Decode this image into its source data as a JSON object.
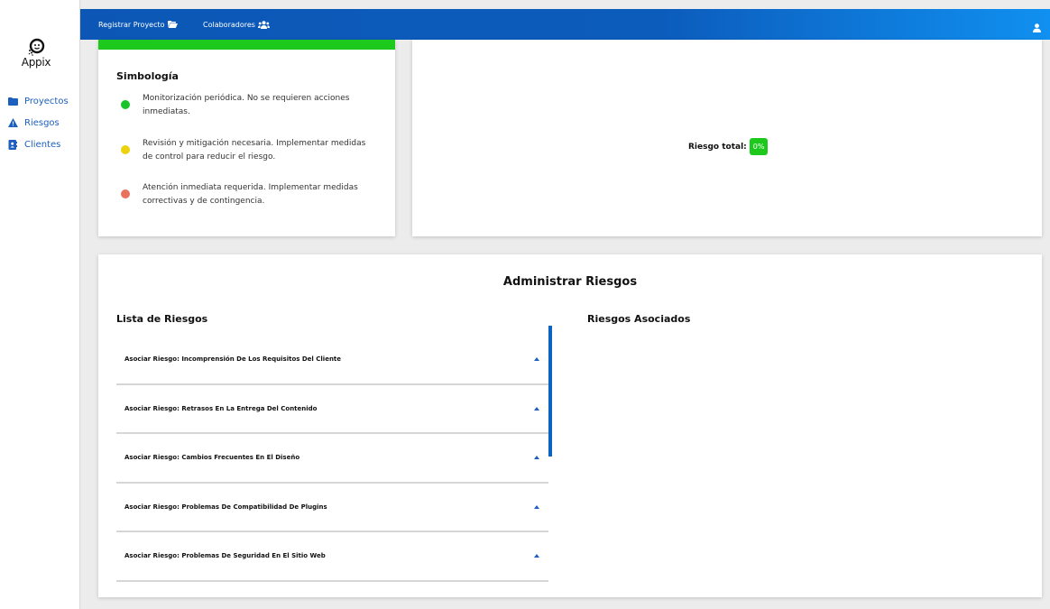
{
  "app": {
    "logo_text": "Appix"
  },
  "sidebar": {
    "items": [
      {
        "label": "Proyectos",
        "icon": "folder-icon"
      },
      {
        "label": "Riesgos",
        "icon": "warning-icon"
      },
      {
        "label": "Clientes",
        "icon": "contact-book-icon"
      }
    ]
  },
  "topbar": {
    "links": [
      {
        "label": "Registrar Proyecto",
        "icon": "folder-open-icon"
      },
      {
        "label": "Colaboradores",
        "icon": "users-icon"
      }
    ],
    "user_icon": "user-icon"
  },
  "simbologia": {
    "title": "Simbología",
    "items": [
      {
        "color": "#19c42a",
        "text": "Monitorización periódica. No se requieren acciones inmediatas."
      },
      {
        "color": "#ecd20c",
        "text": "Revisión y mitigación necesaria. Implementar medidas de control para reducir el riesgo."
      },
      {
        "color": "#e8725d",
        "text": "Atención inmediata requerida. Implementar medidas correctivas y de contingencia."
      }
    ]
  },
  "riesgo_total": {
    "label": "Riesgo total:",
    "value": "0%"
  },
  "admin": {
    "title": "Administrar Riesgos",
    "list_title": "Lista de Riesgos",
    "assoc_title": "Riesgos Asociados",
    "risks": [
      "Asociar Riesgo: Incomprensión De Los Requisitos Del Cliente",
      "Asociar Riesgo: Retrasos En La Entrega Del Contenido",
      "Asociar Riesgo: Cambios Frecuentes En El Diseño",
      "Asociar Riesgo: Problemas De Compatibilidad De Plugins",
      "Asociar Riesgo: Problemas De Seguridad En El Sitio Web"
    ]
  },
  "colors": {
    "primary": "#0c57b6",
    "accent_green": "#1ec91e",
    "link": "#1c5fbf"
  }
}
